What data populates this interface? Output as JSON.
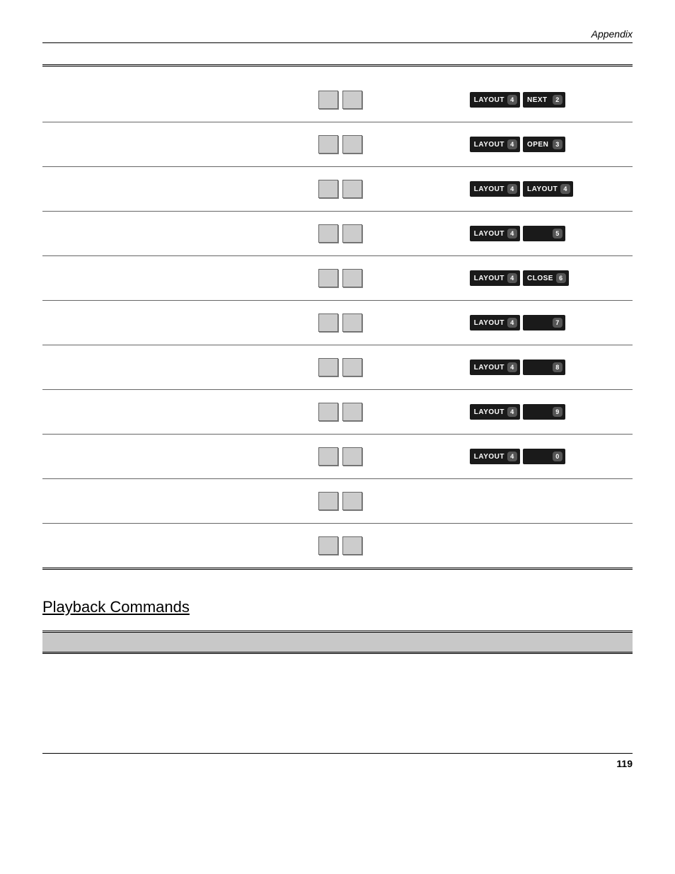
{
  "header": {
    "section": "Appendix"
  },
  "table": {
    "rows": [
      {
        "keys": [
          {
            "label": "LAYOUT",
            "num": "4"
          },
          {
            "label": "NEXT",
            "num": "2"
          }
        ]
      },
      {
        "keys": [
          {
            "label": "LAYOUT",
            "num": "4"
          },
          {
            "label": "OPEN",
            "num": "3"
          }
        ]
      },
      {
        "keys": [
          {
            "label": "LAYOUT",
            "num": "4"
          },
          {
            "label": "LAYOUT",
            "num": "4"
          }
        ]
      },
      {
        "keys": [
          {
            "label": "LAYOUT",
            "num": "4"
          },
          {
            "label": "",
            "num": "5"
          }
        ]
      },
      {
        "keys": [
          {
            "label": "LAYOUT",
            "num": "4"
          },
          {
            "label": "CLOSE",
            "num": "6"
          }
        ]
      },
      {
        "keys": [
          {
            "label": "LAYOUT",
            "num": "4"
          },
          {
            "label": "",
            "num": "7"
          }
        ]
      },
      {
        "keys": [
          {
            "label": "LAYOUT",
            "num": "4"
          },
          {
            "label": "",
            "num": "8"
          }
        ]
      },
      {
        "keys": [
          {
            "label": "LAYOUT",
            "num": "4"
          },
          {
            "label": "",
            "num": "9"
          }
        ]
      },
      {
        "keys": [
          {
            "label": "LAYOUT",
            "num": "4"
          },
          {
            "label": "",
            "num": "0"
          }
        ]
      },
      {
        "keys": null
      },
      {
        "keys": null
      }
    ]
  },
  "section_title": "Playback Commands",
  "page_number": "119"
}
